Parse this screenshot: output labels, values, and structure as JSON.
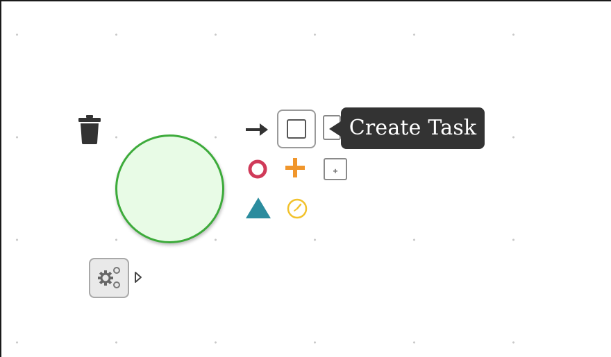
{
  "diagram": {
    "start_event": {
      "kind": "start-event",
      "fill": "#e8fbe6",
      "stroke": "#3dab3b"
    },
    "palette": {
      "delete": {
        "icon": "trash-icon",
        "color": "#333333"
      },
      "connect": {
        "icon": "arrow-right-icon",
        "color": "#333333"
      },
      "create_task": {
        "icon": "task-icon"
      },
      "end_event": {
        "icon": "end-event-circle-icon",
        "color": "#d03a59"
      },
      "gateway": {
        "icon": "parallel-gateway-plus-icon",
        "color": "#f0962c"
      },
      "subprocess": {
        "icon": "subprocess-icon",
        "color": "#888888"
      },
      "intermediate_event": {
        "icon": "triangle-signal-icon",
        "color": "#2b8c9e"
      },
      "timer_event": {
        "icon": "timer-clock-icon",
        "color": "#f2c22c"
      },
      "morph": {
        "icon": "gears-icon"
      },
      "morph_more": {
        "icon": "chevron-right-icon"
      }
    },
    "tooltip": {
      "text": "Create Task",
      "bg": "#333333"
    }
  }
}
